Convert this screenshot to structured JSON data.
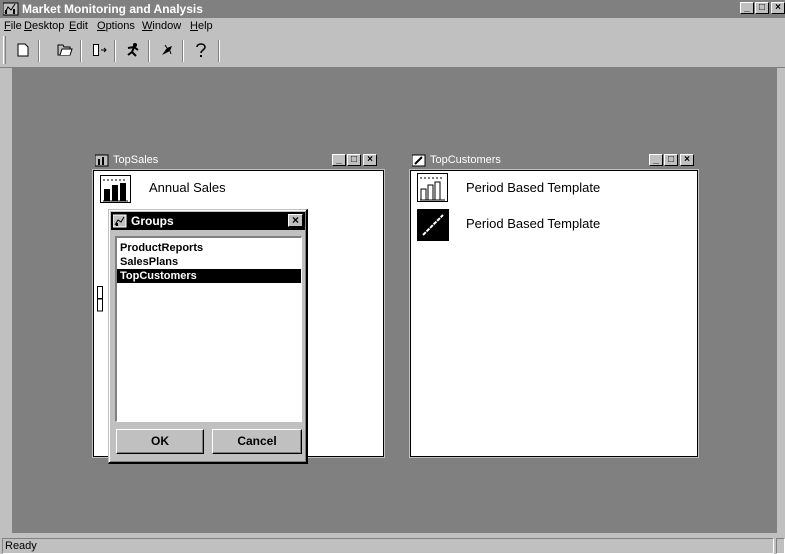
{
  "app": {
    "title": "Market Monitoring and Analysis",
    "caption_buttons": [
      "_",
      "□",
      "×"
    ]
  },
  "menu": [
    {
      "label": "File",
      "accel": "F",
      "rest": "ile"
    },
    {
      "label": "Desktop",
      "accel": "D",
      "rest": "esktop"
    },
    {
      "label": "Edit",
      "accel": "E",
      "rest": "dit"
    },
    {
      "label": "Options",
      "accel": "O",
      "rest": "ptions"
    },
    {
      "label": "Window",
      "accel": "W",
      "rest": "indow"
    },
    {
      "label": "Help",
      "accel": "H",
      "rest": "elp"
    }
  ],
  "toolbar": {
    "buttons": [
      "new-document-icon",
      "open-folder-icon",
      "exit-door-icon",
      "run-figure-icon",
      "cursor-tool-icon",
      "help-question-icon"
    ]
  },
  "windows": {
    "topsales": {
      "title": "TopSales",
      "items": [
        {
          "label": "Annual Sales",
          "icon": "bar-chart-icon"
        }
      ]
    },
    "topcustomers": {
      "title": "TopCustomers",
      "items": [
        {
          "label": "Period Based Template",
          "icon": "bar-chart-icon"
        },
        {
          "label": "Period Based Template",
          "icon": "line-chart-icon"
        }
      ]
    }
  },
  "dialog": {
    "title": "Groups",
    "close": "×",
    "list": [
      "ProductReports",
      "SalesPlans",
      "TopCustomers"
    ],
    "selected_index": 2,
    "ok_label": "OK",
    "cancel_label": "Cancel"
  },
  "status": {
    "text": "Ready"
  }
}
